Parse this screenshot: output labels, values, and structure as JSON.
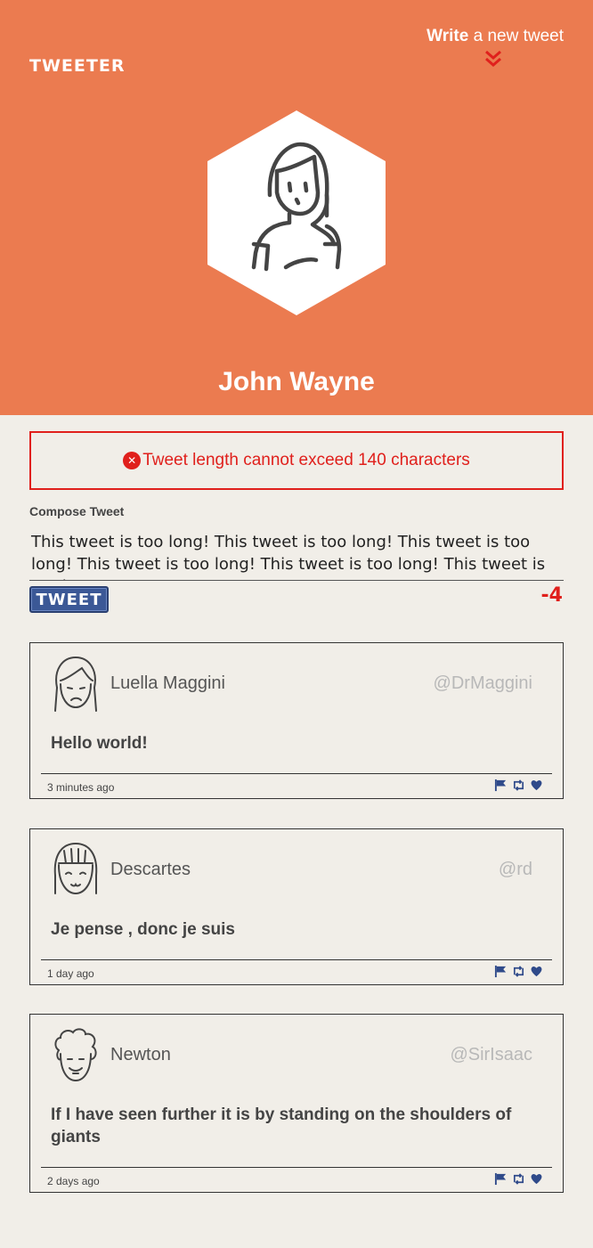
{
  "header": {
    "logo": "TWEETER",
    "write_bold": "Write",
    "write_rest": " a new tweet",
    "user_name": "John Wayne",
    "bg_color": "#eb7b50"
  },
  "error": {
    "message": "Tweet length cannot exceed 140 characters",
    "icon": "x-circle-icon"
  },
  "compose": {
    "label": "Compose Tweet",
    "value": "This tweet is too long! This tweet is too long! This tweet is too long! This tweet is too long! This tweet is too long! This tweet is too long!",
    "button_label": "TWEET",
    "counter": "-4"
  },
  "tweets": [
    {
      "name": "Luella Maggini",
      "handle": "@DrMaggini",
      "content": "Hello world!",
      "time": "3 minutes ago"
    },
    {
      "name": "Descartes",
      "handle": "@rd",
      "content": "Je pense , donc je suis",
      "time": "1 day ago"
    },
    {
      "name": "Newton",
      "handle": "@SirIsaac",
      "content": "If I have seen further it is by standing on the shoulders of giants",
      "time": "2 days ago"
    }
  ],
  "colors": {
    "accent": "#eb7b50",
    "error": "#e0201c",
    "button": "#3b5896",
    "background": "#f1eee8"
  }
}
